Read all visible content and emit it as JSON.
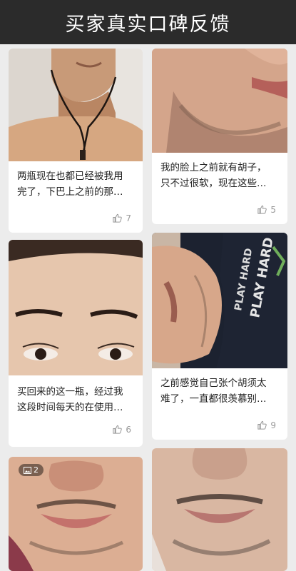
{
  "header": {
    "title": "买家真实口碑反馈"
  },
  "reviews": [
    {
      "text_line1": "两瓶现在也都已经被我用",
      "text_line2": "完了，下巴上之前的那…",
      "likes": "7"
    },
    {
      "text_line1": "我的脸上之前就有胡子，",
      "text_line2": "只不过很软，现在这些…",
      "likes": "5"
    },
    {
      "text_line1": "买回来的这一瓶，经过我",
      "text_line2": "这段时间每天的在使用…",
      "likes": "6"
    },
    {
      "text_line1": "之前感觉自己张个胡须太",
      "text_line2": "难了，一直都很羡慕别…",
      "likes": "9"
    }
  ],
  "gallery_badge": {
    "count": "2",
    "icon": "image-icon"
  },
  "shirt_text": {
    "line1": "PLAY HARD",
    "line2": "PLAY HARD"
  },
  "icons": {
    "like": "thumbs-up-icon"
  },
  "colors": {
    "header_bg": "#2b2b2b",
    "page_bg": "#ececec",
    "muted": "#999999"
  }
}
